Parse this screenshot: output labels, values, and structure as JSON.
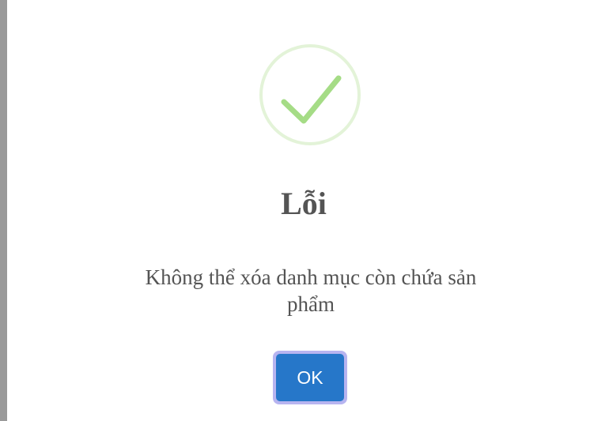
{
  "dialog": {
    "icon": "check-icon",
    "icon_color": "#a5dc86",
    "icon_ring_color": "#e3f3d8",
    "title": "Lỗi",
    "message": "Không thể xóa danh mục còn chứa sản phẩm",
    "ok_label": "OK",
    "ok_color": "#2677c9",
    "ok_focus_ring_color": "#b7b4f0",
    "text_color": "#545454"
  }
}
